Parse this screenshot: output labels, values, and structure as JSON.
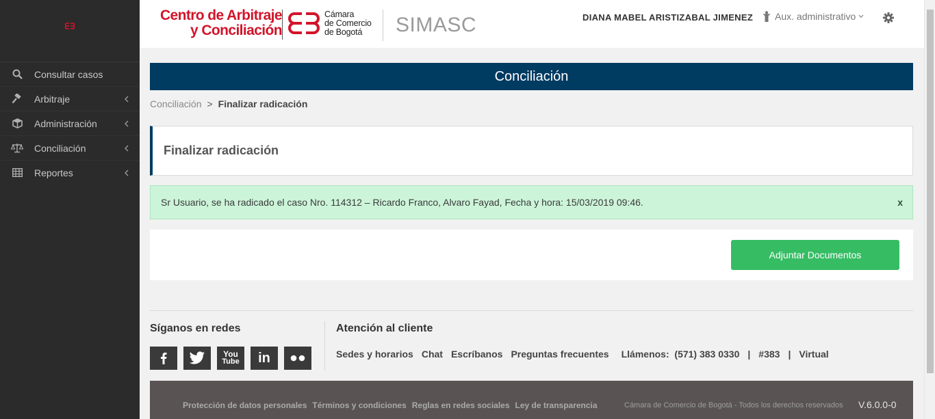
{
  "sidebar": {
    "items": [
      {
        "label": "Consultar casos",
        "icon": "search-icon"
      },
      {
        "label": "Arbitraje",
        "icon": "gavel-icon"
      },
      {
        "label": "Administración",
        "icon": "cube-icon"
      },
      {
        "label": "Conciliación",
        "icon": "scale-icon"
      },
      {
        "label": "Reportes",
        "icon": "table-icon"
      }
    ]
  },
  "header": {
    "logo_line1": "Centro de Arbitraje",
    "logo_line2": "y Conciliación",
    "ccb_line1": "Cámara",
    "ccb_line2": "de Comercio",
    "ccb_line3": "de Bogotá",
    "app_name": "SIMASC",
    "user_name": "DIANA MABEL ARISTIZABAL JIMENEZ",
    "role": "Aux. administrativo",
    "brand_color": "#d2142a"
  },
  "main": {
    "banner_title": "Conciliación",
    "breadcrumb": {
      "parent": "Conciliación",
      "separator": ">",
      "current": "Finalizar radicación"
    },
    "card_title": "Finalizar radicación",
    "alert": {
      "message": "Sr Usuario, se ha radicado el caso Nro. 114312 – Ricardo Franco, Alvaro Fayad, Fecha y hora: 15/03/2019 09:46.",
      "close": "x"
    },
    "attach_button": "Adjuntar Documentos"
  },
  "footer": {
    "social_title": "Síganos en redes",
    "social": [
      "facebook-icon",
      "twitter-icon",
      "youtube-icon",
      "linkedin-icon",
      "flickr-icon"
    ],
    "youtube_text_1": "You",
    "youtube_text_2": "Tube",
    "linkedin_text": "in",
    "attention_title": "Atención al cliente",
    "links": [
      "Sedes y horarios",
      "Chat",
      "Escríbanos",
      "Preguntas frecuentes"
    ],
    "call": "Llámenos:  (571) 383 0330",
    "pipe": "|",
    "hash": "#383",
    "virtual": "Virtual",
    "legal": [
      "Protección de datos personales",
      "Términos y condiciones",
      "Reglas en redes sociales",
      "Ley de transparencia"
    ],
    "rights": "Cámara de Comercio de Bogotá - Todos los derechos reservados",
    "version": "V.6.0.0-0"
  },
  "colors": {
    "sidebar_bg": "#2b2b2b",
    "banner_bg": "#003b62",
    "alert_bg": "#ccf4d9",
    "button_bg": "#36bd64",
    "bottom_bar": "#595453"
  }
}
